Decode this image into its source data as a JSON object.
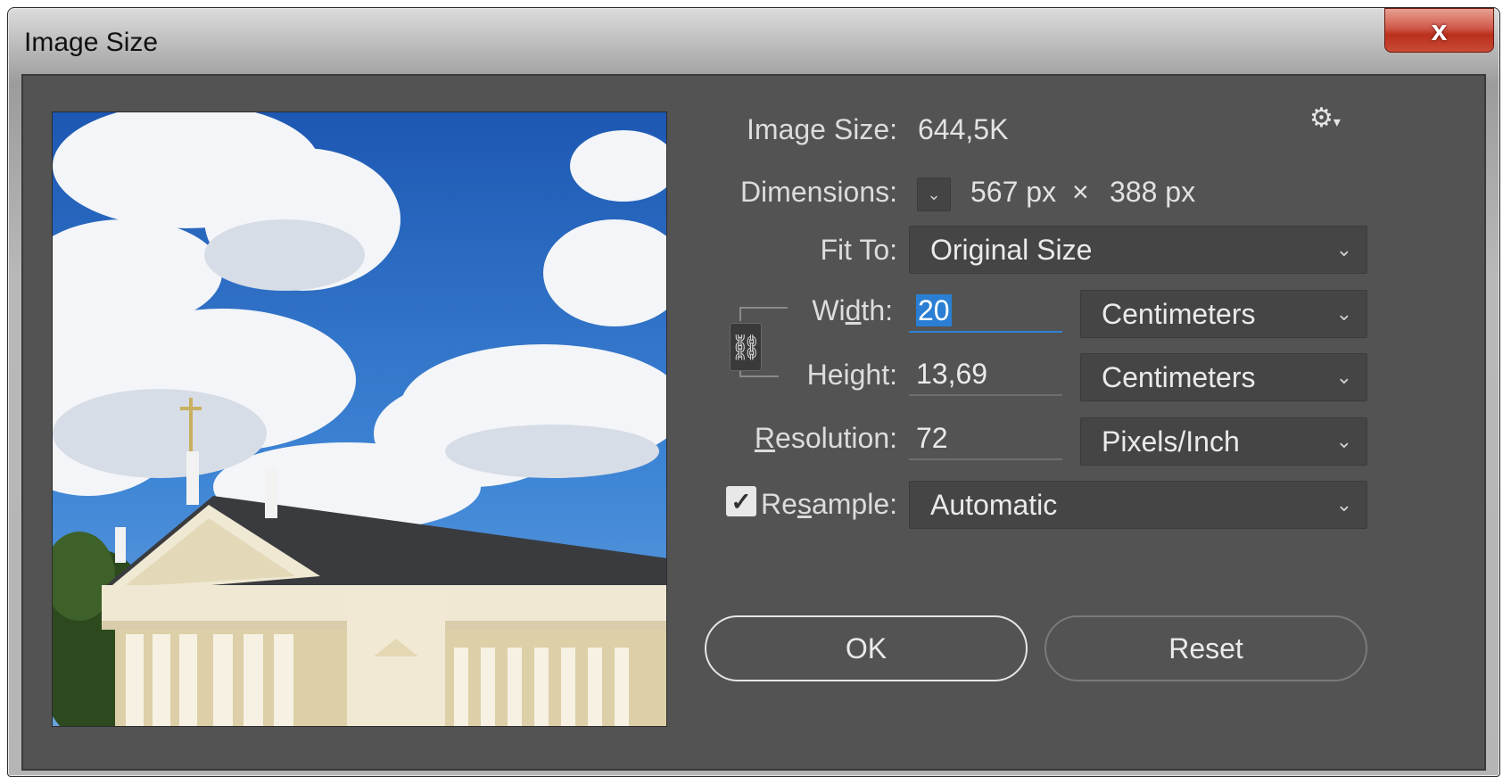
{
  "window": {
    "title": "Image Size",
    "close_glyph": "x"
  },
  "preview": {
    "alt_subject": "cathedral photo preview"
  },
  "settings_icon": "gear-icon",
  "image_size": {
    "label": "Image Size:",
    "value": "644,5K"
  },
  "dimensions": {
    "label": "Dimensions:",
    "width": "567 px",
    "separator": "×",
    "height": "388 px"
  },
  "fit_to": {
    "label": "Fit To:",
    "value": "Original Size"
  },
  "width": {
    "label_pre": "Wi",
    "label_u": "d",
    "label_post": "th:",
    "value": "20",
    "unit": "Centimeters"
  },
  "height": {
    "label_pre": "Hei",
    "label_u": "g",
    "label_post": "ht:",
    "value": "13,69",
    "unit": "Centimeters"
  },
  "resolution": {
    "label_pre": "",
    "label_u": "R",
    "label_post": "esolution:",
    "value": "72",
    "unit": "Pixels/Inch"
  },
  "resample": {
    "label_pre": "Re",
    "label_u": "s",
    "label_post": "ample:",
    "checked": true,
    "value": "Automatic"
  },
  "buttons": {
    "ok": "OK",
    "reset": "Reset"
  },
  "colors": {
    "panel": "#535353",
    "accent": "#2a7fd4",
    "close": "#c94a35"
  }
}
